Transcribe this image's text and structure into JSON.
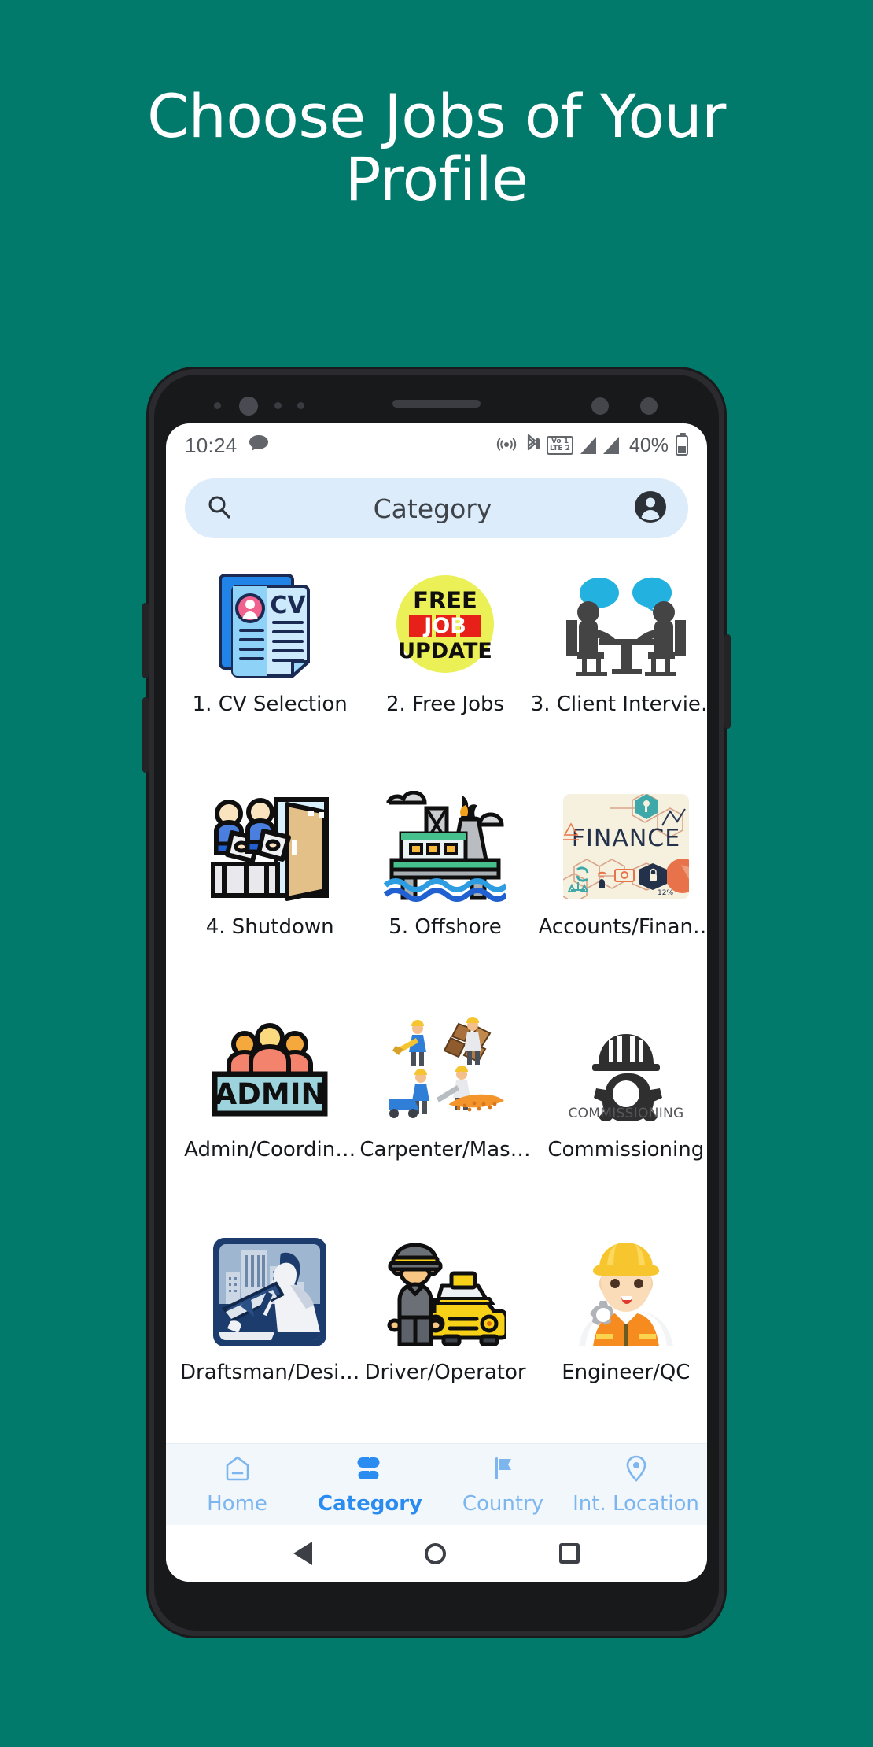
{
  "headline": "Choose Jobs of Your\nProfile",
  "theme": {
    "background": "#017a6b",
    "headline_color": "#ffffff",
    "search_bg": "#dcecfa",
    "nav_bg": "#f2f7fb",
    "nav_active": "#2a8cf0",
    "nav_inactive": "#7db6ef"
  },
  "phone": {
    "statusbar": {
      "time": "10:24",
      "icons_left": [
        "chat-bubble-icon"
      ],
      "icons_right": [
        "hotspot-icon",
        "bluetooth-icon",
        "volte-icon",
        "signal-icon",
        "signal-icon"
      ],
      "volte_line1": "Vo 1",
      "volte_line2": "LTE 2",
      "battery_percent": "40%"
    },
    "search": {
      "icon": "search-icon",
      "value": "Category",
      "placeholder": "Category",
      "account_icon": "account-circle-icon"
    },
    "grid": [
      {
        "id": "cv-selection",
        "label": "1. CV Selection",
        "icon": "cv-documents-icon"
      },
      {
        "id": "free-jobs",
        "label": "2. Free Jobs",
        "icon": "free-job-update-icon"
      },
      {
        "id": "client-interview",
        "label": "3. Client Intervie…",
        "icon": "interview-table-icon"
      },
      {
        "id": "shutdown",
        "label": "4. Shutdown",
        "icon": "workers-door-icon"
      },
      {
        "id": "offshore",
        "label": "5. Offshore",
        "icon": "oil-rig-icon"
      },
      {
        "id": "accounts-finance",
        "label": "Accounts/Finan…",
        "icon": "finance-infographic-icon"
      },
      {
        "id": "admin-coordinator",
        "label": "Admin/Coordin…",
        "icon": "admin-banner-icon"
      },
      {
        "id": "carpenter-mason",
        "label": "Carpenter/Mas…",
        "icon": "construction-workers-icon"
      },
      {
        "id": "commissioning",
        "label": "Commissioning",
        "icon": "helmet-gear-icon"
      },
      {
        "id": "draftsman-designer",
        "label": "Draftsman/Desi…",
        "icon": "drafting-desk-icon"
      },
      {
        "id": "driver-operator",
        "label": "Driver/Operator",
        "icon": "driver-taxi-icon"
      },
      {
        "id": "engineer-qc",
        "label": "Engineer/QC",
        "icon": "engineer-helmet-icon"
      }
    ],
    "icon_text": {
      "cv": "CV",
      "free": "FREE",
      "job": "JOB",
      "update": "UPDATE",
      "finance": "FINANCE",
      "finance_pct": "12%",
      "admin": "ADMIN",
      "commissioning": "COMMISSIONING"
    },
    "bottomnav": [
      {
        "id": "home",
        "label": "Home",
        "icon": "home-icon",
        "active": false
      },
      {
        "id": "category",
        "label": "Category",
        "icon": "grid-icon",
        "active": true
      },
      {
        "id": "country",
        "label": "Country",
        "icon": "flag-icon",
        "active": false
      },
      {
        "id": "int-location",
        "label": "Int. Location",
        "icon": "location-pin-icon",
        "active": false
      }
    ],
    "androidnav": [
      "back-icon",
      "home-circle-icon",
      "recents-square-icon"
    ]
  }
}
